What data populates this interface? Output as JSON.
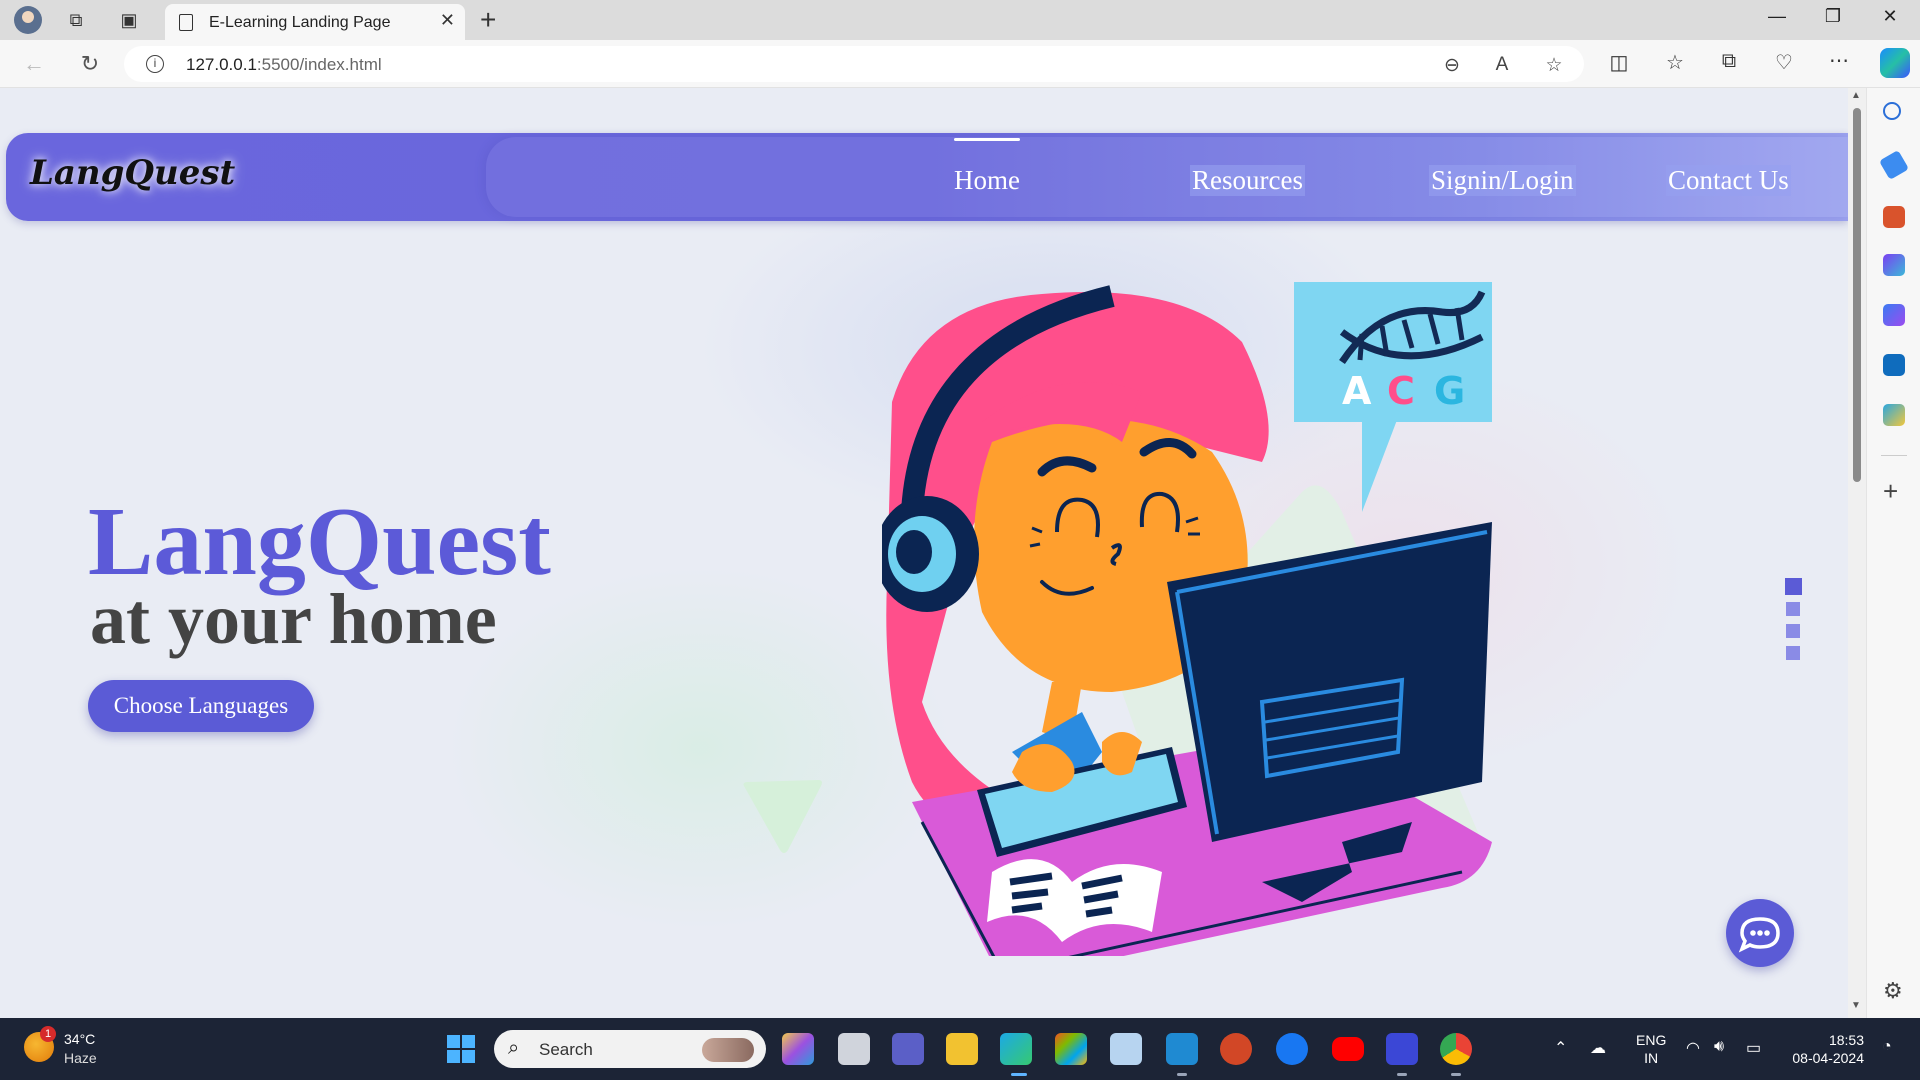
{
  "browser": {
    "tab_title": "E-Learning Landing Page",
    "url_host": "127.0.0.1",
    "url_path": ":5500/index.html"
  },
  "page": {
    "logo": "LangQuest",
    "nav": [
      {
        "label": "Home",
        "active": true
      },
      {
        "label": "Resources",
        "active": false
      },
      {
        "label": "Signin/Login",
        "active": false
      },
      {
        "label": "Contact Us",
        "active": false
      }
    ],
    "hero_title": "LangQuest",
    "hero_subtitle": "at your home",
    "cta_label": "Choose Languages",
    "speech_bubble_letters": [
      "A",
      "C",
      "G"
    ],
    "slider": {
      "count": 4,
      "active_index": 0
    }
  },
  "colors": {
    "accent": "#5b5bd6",
    "navbar": "#6a66dd",
    "hero_subtitle": "#444444",
    "illus_hair": "#ff4f8b",
    "illus_skin": "#ff9f2e",
    "illus_desk": "#d95ad8",
    "illus_monitor": "#0b2552",
    "illus_bubble": "#7fd6f2"
  },
  "taskbar": {
    "weather_temp": "34°C",
    "weather_desc": "Haze",
    "weather_badge": "1",
    "search_label": "Search",
    "lang_top": "ENG",
    "lang_bottom": "IN",
    "time": "18:53",
    "date": "08-04-2024"
  }
}
